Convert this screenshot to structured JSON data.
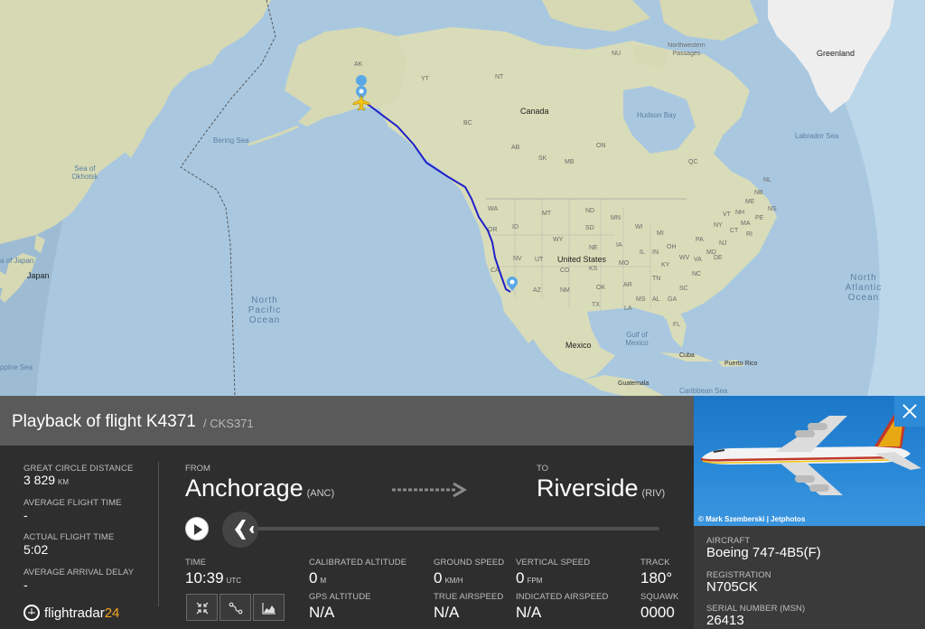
{
  "map": {
    "labels": {
      "greenland": "Greenland",
      "northwest_passages": "Northwestern Passages",
      "canada": "Canada",
      "hudson_bay": "Hudson Bay",
      "labrador_sea": "Labrador Sea",
      "bering_sea": "Bering Sea",
      "sea_of_okhotsk": "Sea of Okhotsk",
      "japan": "Japan",
      "sea_of_japan": "a of Japan",
      "north_pacific_ocean": "North\nPacific\nOcean",
      "north_atlantic_ocean": "North\nAtlantic\nOcean",
      "united_states": "United States",
      "mexico": "Mexico",
      "gulf_of_mexico": "Gulf of\nMexico",
      "cuba": "Cuba",
      "puerto_rico": "Puerto Rico",
      "guatemala": "Guatemala",
      "caribbean_sea": "Caribbean Sea",
      "philippine_sea": "ppine Sea",
      "ak": "AK",
      "yt": "YT",
      "nt": "NT",
      "nu": "NU",
      "bc": "BC",
      "ab": "AB",
      "sk": "SK",
      "mb": "MB",
      "on": "ON",
      "qc": "QC",
      "nl": "NL",
      "wa": "WA",
      "or": "OR",
      "id": "ID",
      "mt": "MT",
      "nd": "ND",
      "sd": "SD",
      "mn": "MN",
      "wi": "WI",
      "mi": "MI",
      "wy": "WY",
      "ne": "NE",
      "ia": "IA",
      "nv": "NV",
      "ut": "UT",
      "co": "CO",
      "ks": "KS",
      "mo": "MO",
      "il": "IL",
      "in": "IN",
      "oh": "OH",
      "pa": "PA",
      "ny": "NY",
      "ca": "CA",
      "az": "AZ",
      "nm": "NM",
      "ok": "OK",
      "ar": "AR",
      "tn": "TN",
      "ky": "KY",
      "va": "VA",
      "nc": "NC",
      "sc": "SC",
      "ga": "GA",
      "al": "AL",
      "ms": "MS",
      "la": "LA",
      "tx": "TX",
      "fl": "FL",
      "md": "MD",
      "nj": "NJ",
      "ct": "CT",
      "ma": "MA",
      "vt": "VT",
      "nh": "NH",
      "me": "ME",
      "nb": "NB",
      "ns": "NS",
      "pe": "PE",
      "wv": "WV",
      "de": "DE",
      "ri": "RI"
    },
    "route_color": "#2020c8"
  },
  "header": {
    "title": "Playback of flight K4371",
    "callsign": "/ CKS371"
  },
  "stats": {
    "great_circle_distance_label": "GREAT CIRCLE DISTANCE",
    "great_circle_distance_value": "3 829",
    "great_circle_distance_unit": "KM",
    "average_flight_time_label": "AVERAGE FLIGHT TIME",
    "average_flight_time_value": "-",
    "actual_flight_time_label": "ACTUAL FLIGHT TIME",
    "actual_flight_time_value": "5:02",
    "average_arrival_delay_label": "AVERAGE ARRIVAL DELAY",
    "average_arrival_delay_value": "-"
  },
  "route": {
    "from_label": "FROM",
    "from_city": "Anchorage",
    "from_code": "(ANC)",
    "to_label": "TO",
    "to_city": "Riverside",
    "to_code": "(RIV)"
  },
  "playback": {
    "progress": 0
  },
  "telemetry": {
    "time_label": "TIME",
    "time_value": "10:39",
    "time_unit": "UTC",
    "calibrated_altitude_label": "CALIBRATED ALTITUDE",
    "calibrated_altitude_value": "0",
    "calibrated_altitude_unit": "M",
    "gps_altitude_label": "GPS ALTITUDE",
    "gps_altitude_value": "N/A",
    "ground_speed_label": "GROUND SPEED",
    "ground_speed_value": "0",
    "ground_speed_unit": "KM/H",
    "true_airspeed_label": "TRUE AIRSPEED",
    "true_airspeed_value": "N/A",
    "vertical_speed_label": "VERTICAL SPEED",
    "vertical_speed_value": "0",
    "vertical_speed_unit": "FPM",
    "indicated_airspeed_label": "INDICATED AIRSPEED",
    "indicated_airspeed_value": "N/A",
    "track_label": "TRACK",
    "track_value": "180°",
    "squawk_label": "SQUAWK",
    "squawk_value": "0000"
  },
  "logo": {
    "text": "flightradar",
    "number": "24"
  },
  "aircraft": {
    "photo_credit": "© Mark Szemberski | Jetphotos",
    "aircraft_label": "AIRCRAFT",
    "aircraft_value": "Boeing 747-4B5(F)",
    "registration_label": "REGISTRATION",
    "registration_value": "N705CK",
    "serial_label": "SERIAL NUMBER (MSN)",
    "serial_value": "26413"
  },
  "colors": {
    "panel_bg": "#2e2e2e",
    "header_bg": "#5a5a5a",
    "accent_blue": "#2c8ad6",
    "logo_orange": "#f5a623",
    "map_land": "#d9dcb8",
    "map_water": "#a9c8e0"
  },
  "icons": {
    "play": "play-icon",
    "plane": "plane-icon",
    "close": "close-icon",
    "fit": "fit-bounds-icon",
    "route": "route-icon",
    "graph": "altitude-graph-icon",
    "origin_marker": "origin-pin-icon",
    "destination_marker": "destination-pin-icon"
  }
}
